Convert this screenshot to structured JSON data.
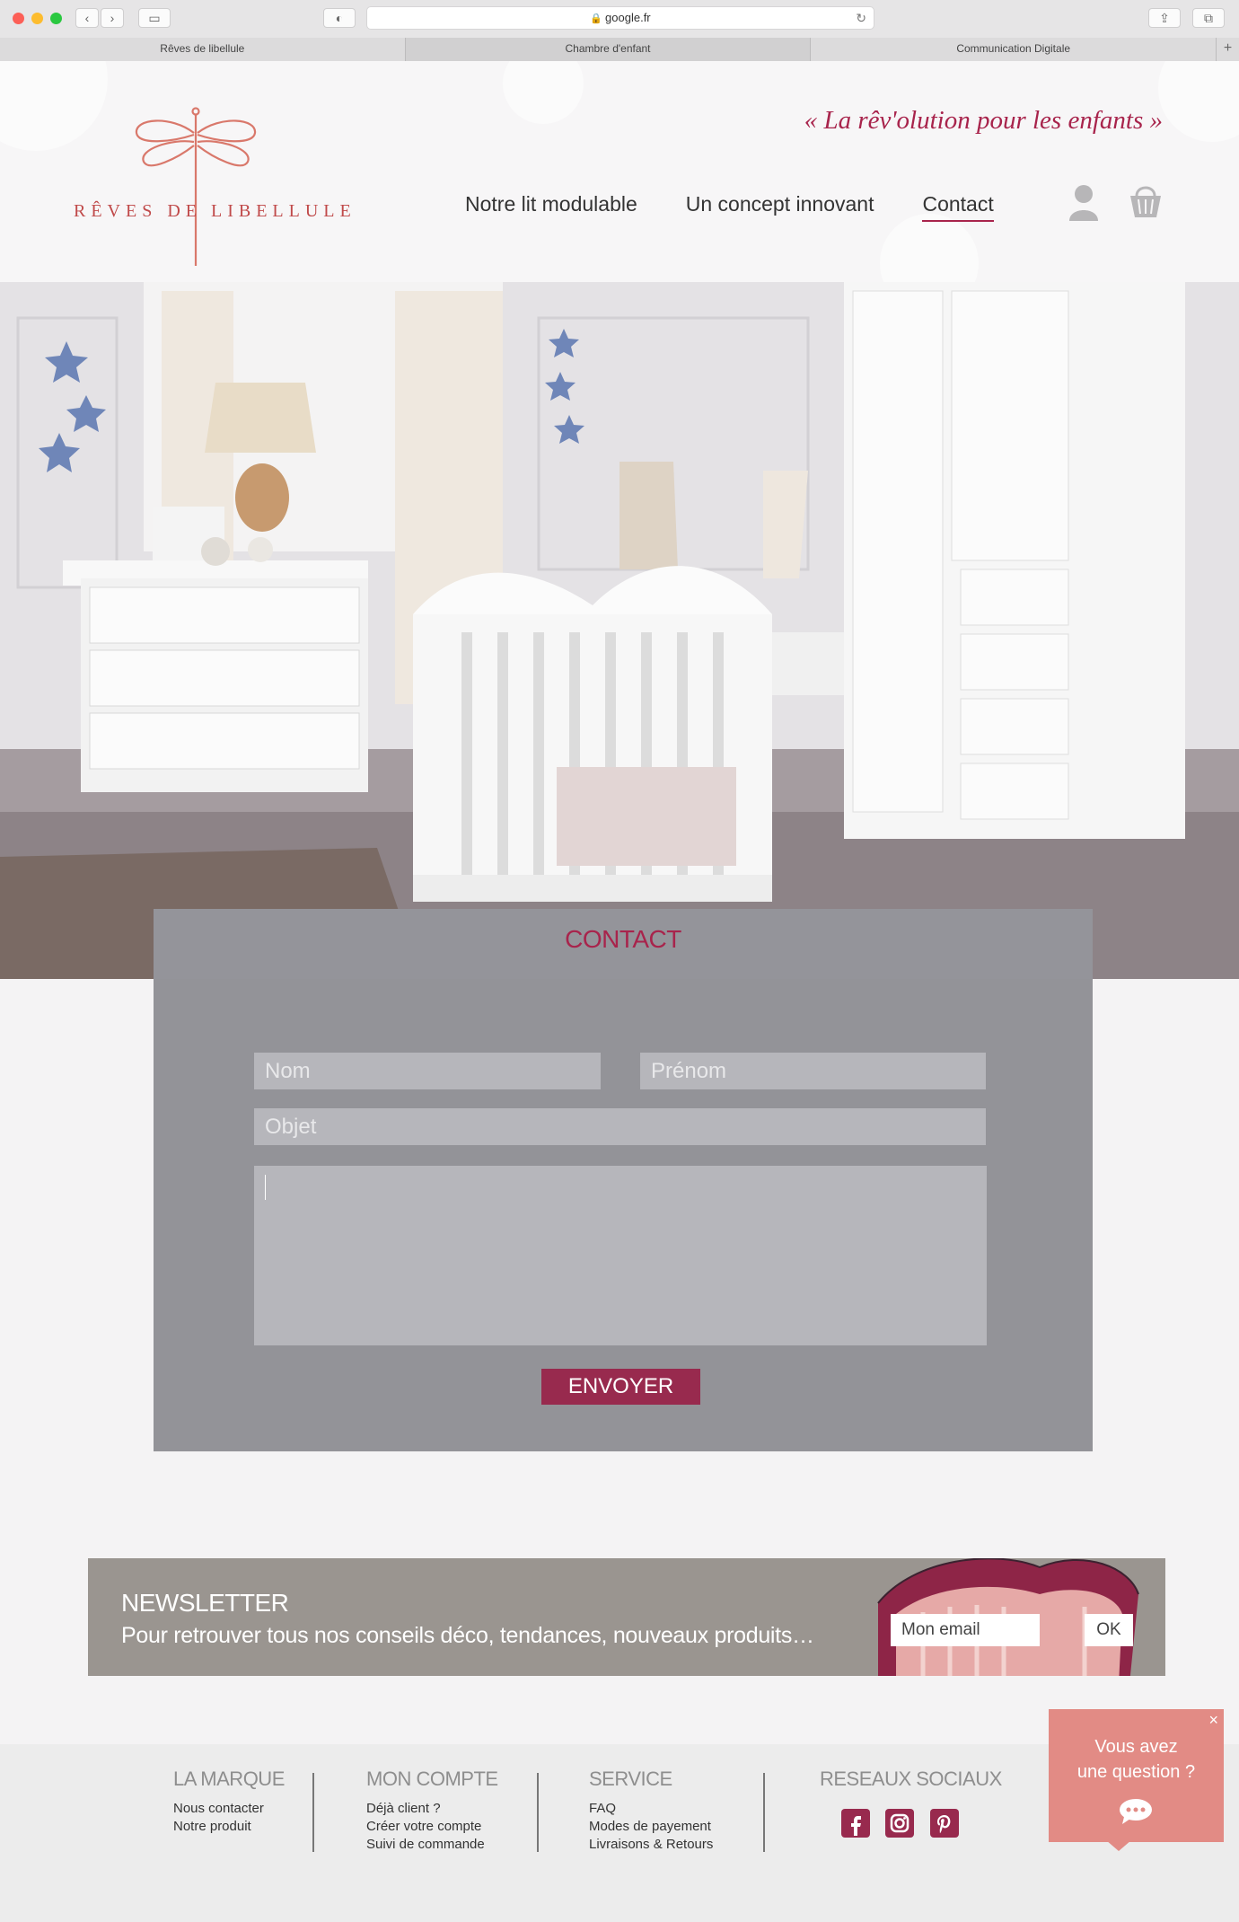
{
  "browser": {
    "url": "google.fr",
    "tabs": [
      "Rêves de libellule",
      "Chambre d'enfant",
      "Communication Digitale"
    ],
    "new_tab": "+"
  },
  "header": {
    "logo_word1": "RÊVES DE",
    "logo_word2": "LIBELLULE",
    "tagline": "« La rêv'olution pour les enfants »",
    "nav": [
      "Notre lit modulable",
      "Un concept innovant",
      "Contact"
    ],
    "active_nav": "Contact",
    "icons": [
      "user-icon",
      "shopping-bag-icon"
    ]
  },
  "contact": {
    "title": "CONTACT",
    "placeholders": {
      "nom": "Nom",
      "prenom": "Prénom",
      "objet": "Objet"
    },
    "send": "ENVOYER"
  },
  "newsletter": {
    "title": "NEWSLETTER",
    "subtitle": "Pour retrouver tous nos conseils déco, tendances, nouveaux produits…",
    "email_placeholder": "Mon email",
    "ok": "OK"
  },
  "footer": {
    "columns": [
      {
        "title": "LA MARQUE",
        "links": [
          "Nous contacter",
          "Notre produit"
        ]
      },
      {
        "title": "MON COMPTE",
        "links": [
          "Déjà client ?",
          "Créer votre compte",
          "Suivi de commande"
        ]
      },
      {
        "title": "SERVICE",
        "links": [
          "FAQ",
          "Modes de payement",
          "Livraisons & Retours"
        ]
      },
      {
        "title": "RESEAUX SOCIAUX",
        "links": []
      }
    ],
    "socials": [
      "facebook-icon",
      "instagram-icon",
      "pinterest-icon"
    ]
  },
  "chat": {
    "line1": "Vous avez",
    "line2": "une question ?"
  },
  "colors": {
    "brand": "#a8244c",
    "button": "#982a4e",
    "logo": "#c04a4a",
    "chat": "#e28b85"
  }
}
